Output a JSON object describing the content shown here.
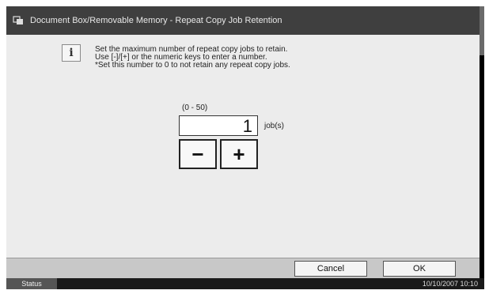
{
  "window": {
    "title": "Document Box/Removable Memory - Repeat Copy Job Retention"
  },
  "info": {
    "lines": [
      "Set the maximum number of repeat copy jobs to retain.",
      "Use [-]/[+] or the numeric keys to enter a number.",
      "*Set this number to 0 to not retain any repeat copy jobs."
    ]
  },
  "setting": {
    "range": "(0 - 50)",
    "value": "1",
    "unit": "job(s)",
    "minus_label": "−",
    "plus_label": "+"
  },
  "buttons": {
    "cancel": "Cancel",
    "ok": "OK"
  },
  "statusbar": {
    "status_label": "Status",
    "datetime": "10/10/2007  10:10"
  }
}
